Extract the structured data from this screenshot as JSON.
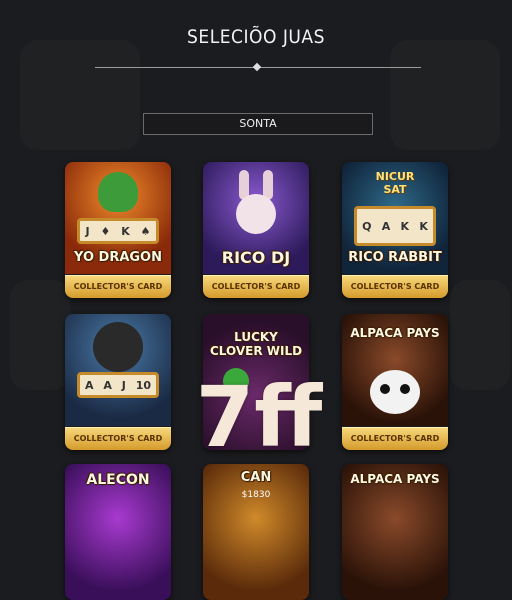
{
  "header": {
    "title": "SELECIÕO JUAS"
  },
  "search": {
    "value": "SONTA"
  },
  "cards": [
    {
      "name": "YO DRAGON",
      "footer": "COLLECTOR'S CARD"
    },
    {
      "name": "RICO DJ",
      "footer": "COLLECTOR'S CARD"
    },
    {
      "name": "RICO RABBIT",
      "footer": "COLLECTOR'S CARD",
      "badge": "NICUR SAT",
      "reels": [
        "Q",
        "A",
        "K",
        "K"
      ]
    },
    {
      "name": "",
      "footer": "COLLECTOR'S CARD"
    },
    {
      "name": "LUCKY CLOVER WILD",
      "footer": ""
    },
    {
      "name": "ALPACA PAYS",
      "footer": "COLLECTOR'S CARD"
    },
    {
      "name": "ALECON",
      "footer": ""
    },
    {
      "name": "CAN",
      "footer": "",
      "sub": "$1830"
    },
    {
      "name": "ALPACA PAYS",
      "footer": ""
    }
  ],
  "overlay": {
    "text": "7ff"
  },
  "colors": {
    "background": "#1b1c1f",
    "footer_gold": "#e2b24a",
    "footer_text": "#5a3300"
  }
}
